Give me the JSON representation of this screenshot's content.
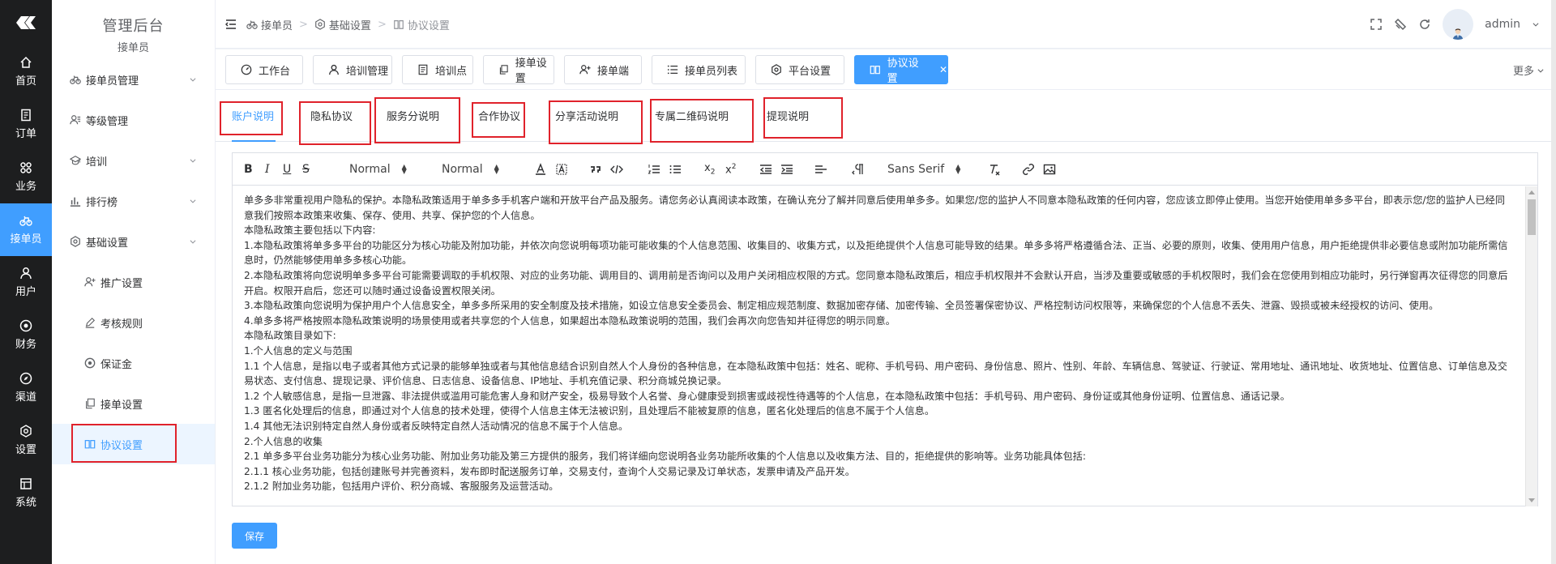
{
  "rail": {
    "items": [
      {
        "label": "首页",
        "icon": "home-icon"
      },
      {
        "label": "订单",
        "icon": "order-icon"
      },
      {
        "label": "业务",
        "icon": "grid-icon"
      },
      {
        "label": "接单员",
        "icon": "bicycle-icon"
      },
      {
        "label": "用户",
        "icon": "user-icon"
      },
      {
        "label": "财务",
        "icon": "coin-icon"
      },
      {
        "label": "渠道",
        "icon": "compass-icon"
      },
      {
        "label": "设置",
        "icon": "gear-icon"
      },
      {
        "label": "系统",
        "icon": "system-icon"
      }
    ],
    "active_index": 3
  },
  "sidebar": {
    "title": "管理后台",
    "subtitle": "接单员",
    "items": [
      {
        "label": "接单员管理",
        "icon": "bicycle-icon",
        "expandable": true
      },
      {
        "label": "等级管理",
        "icon": "user-level-icon",
        "expandable": false
      },
      {
        "label": "培训",
        "icon": "training-icon",
        "expandable": true
      },
      {
        "label": "排行榜",
        "icon": "bar-chart-icon",
        "expandable": true
      },
      {
        "label": "基础设置",
        "icon": "gear-icon",
        "expandable": true
      }
    ],
    "children": [
      {
        "label": "推广设置",
        "icon": "user-add-icon"
      },
      {
        "label": "考核规则",
        "icon": "edit-icon"
      },
      {
        "label": "保证金",
        "icon": "coin-icon"
      },
      {
        "label": "接单设置",
        "icon": "copy-icon"
      },
      {
        "label": "协议设置",
        "icon": "book-icon"
      }
    ],
    "active_child": 4
  },
  "header": {
    "breadcrumb": [
      "接单员",
      "基础设置",
      "协议设置"
    ],
    "username": "admin"
  },
  "tabs": {
    "items": [
      {
        "label": "工作台",
        "icon": "dashboard-icon"
      },
      {
        "label": "培训管理",
        "icon": "user-icon"
      },
      {
        "label": "培训点",
        "icon": "document-icon"
      },
      {
        "label": "接单设置",
        "icon": "copy-icon"
      },
      {
        "label": "接单端",
        "icon": "user-add-icon"
      },
      {
        "label": "接单员列表",
        "icon": "list-icon"
      },
      {
        "label": "平台设置",
        "icon": "gear-icon"
      },
      {
        "label": "协议设置",
        "icon": "book-icon"
      }
    ],
    "active_index": 7,
    "more_label": "更多"
  },
  "page_tabs": {
    "items": [
      "账户说明",
      "隐私协议",
      "服务分说明",
      "合作协议",
      "分享活动说明",
      "专属二维码说明",
      "提现说明"
    ],
    "active_index": 0
  },
  "editor": {
    "toolbar": {
      "header_select": "Normal",
      "size_select": "Normal",
      "font_select": "Sans Serif"
    },
    "content": [
      "单多多非常重视用户隐私的保护。本隐私政策适用于单多多手机客户端和开放平台产品及服务。请您务必认真阅读本政策，在确认充分了解并同意后使用单多多。如果您/您的监护人不同意本隐私政策的任何内容，您应该立即停止使用。当您开始使用单多多平台，即表示您/您的监护人已经同意我们按照本政策来收集、保存、使用、共享、保护您的个人信息。",
      "本隐私政策主要包括以下内容:",
      "1.本隐私政策将单多多平台的功能区分为核心功能及附加功能，并依次向您说明每项功能可能收集的个人信息范围、收集目的、收集方式，以及拒绝提供个人信息可能导致的结果。单多多将严格遵循合法、正当、必要的原则，收集、使用用户信息，用户拒绝提供非必要信息或附加功能所需信息时，仍然能够使用单多多核心功能。",
      "2.本隐私政策将向您说明单多多平台可能需要调取的手机权限、对应的业务功能、调用目的、调用前是否询问以及用户关闭相应权限的方式。您同意本隐私政策后，相应手机权限并不会默认开启，当涉及重要或敏感的手机权限时，我们会在您使用到相应功能时，另行弹窗再次征得您的同意后开启。权限开启后，您还可以随时通过设备设置权限关闭。",
      "3.本隐私政策向您说明为保护用户个人信息安全，单多多所采用的安全制度及技术措施，如设立信息安全委员会、制定相应规范制度、数据加密存储、加密传输、全员签署保密协议、严格控制访问权限等，来确保您的个人信息不丢失、泄露、毁损或被未经授权的访问、使用。",
      "4.单多多将严格按照本隐私政策说明的场景使用或者共享您的个人信息，如果超出本隐私政策说明的范围，我们会再次向您告知并征得您的明示同意。",
      "本隐私政策目录如下:",
      "1.个人信息的定义与范围",
      "1.1 个人信息，是指以电子或者其他方式记录的能够单独或者与其他信息结合识别自然人个人身份的各种信息，在本隐私政策中包括：姓名、昵称、手机号码、用户密码、身份信息、照片、性别、年龄、车辆信息、驾驶证、行驶证、常用地址、通讯地址、收货地址、位置信息、订单信息及交易状态、支付信息、提现记录、评价信息、日志信息、设备信息、IP地址、手机充值记录、积分商城兑换记录。",
      "1.2 个人敏感信息，是指一旦泄露、非法提供或滥用可能危害人身和财产安全，极易导致个人名誉、身心健康受到损害或歧视性待遇等的个人信息，在本隐私政策中包括：手机号码、用户密码、身份证或其他身份证明、位置信息、通话记录。",
      "1.3 匿名化处理后的信息，即通过对个人信息的技术处理，使得个人信息主体无法被识别，且处理后不能被复原的信息，匿名化处理后的信息不属于个人信息。",
      "1.4 其他无法识别特定自然人身份或者反映特定自然人活动情况的信息不属于个人信息。",
      "2.个人信息的收集",
      "2.1 单多多平台业务功能分为核心业务功能、附加业务功能及第三方提供的服务，我们将详细向您说明各业务功能所收集的个人信息以及收集方法、目的，拒绝提供的影响等。业务功能具体包括:",
      "2.1.1 核心业务功能，包括创建账号并完善资料，发布即时配送服务订单，交易支付，查询个人交易记录及订单状态，发票申请及产品开发。",
      "2.1.2 附加业务功能，包括用户评价、积分商城、客服服务及运营活动。"
    ]
  },
  "actions": {
    "save_label": "保存"
  },
  "colors": {
    "primary": "#409eff",
    "rail_bg": "#1d1e1f",
    "annotation_red": "#e0222b"
  }
}
